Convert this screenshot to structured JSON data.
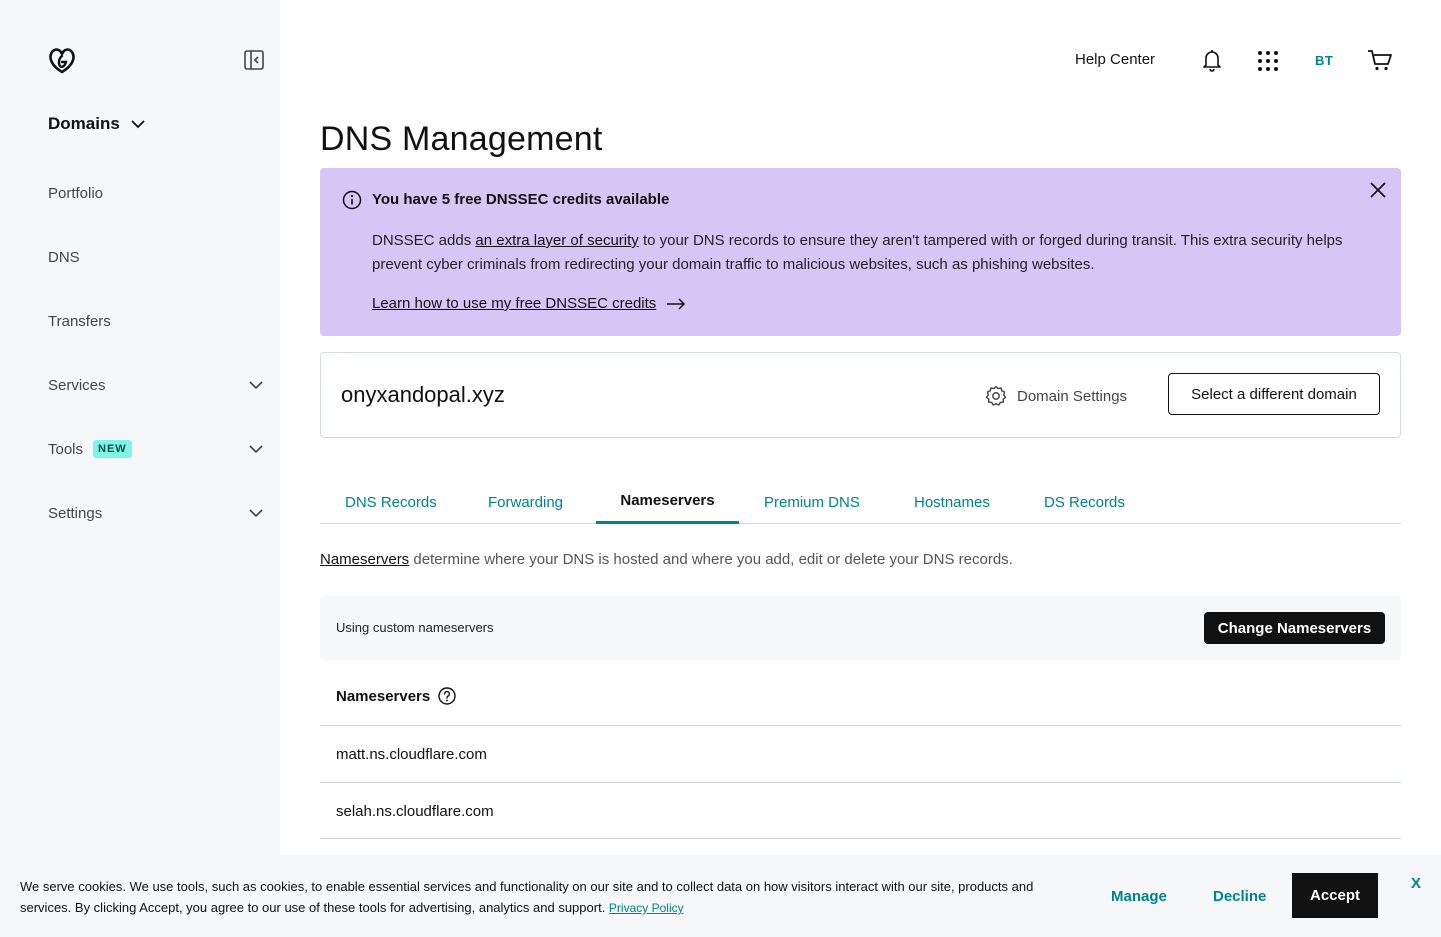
{
  "sidebar": {
    "logo_icon": "godaddy-logo-icon",
    "collapse_icon": "sidebar-collapse-icon",
    "section_title": "Domains",
    "items": [
      {
        "label": "Portfolio"
      },
      {
        "label": "DNS"
      },
      {
        "label": "Transfers"
      },
      {
        "label": "Services",
        "expandable": true
      },
      {
        "label": "Tools",
        "badge": "NEW",
        "expandable": true
      },
      {
        "label": "Settings",
        "expandable": true
      }
    ]
  },
  "topbar": {
    "help_label": "Help Center",
    "avatar_initials": "BT"
  },
  "page": {
    "title": "DNS Management"
  },
  "alert": {
    "title": "You have 5 free DNSSEC credits available",
    "body_prefix": "DNSSEC adds ",
    "body_link": "an extra layer of security",
    "body_suffix": " to your DNS records to ensure they aren't tampered with or forged during transit. This extra security helps prevent cyber criminals from redirecting your domain traffic to malicious websites, such as phishing websites.",
    "learn_link": "Learn how to use my free DNSSEC credits",
    "background_color": "#d6c6f5"
  },
  "domain": {
    "name": "onyxandopal.xyz",
    "settings_label": "Domain Settings",
    "select_label": "Select a different domain"
  },
  "tabs": [
    {
      "label": "DNS Records",
      "active": false
    },
    {
      "label": "Forwarding",
      "active": false
    },
    {
      "label": "Nameservers",
      "active": true
    },
    {
      "label": "Premium DNS",
      "active": false
    },
    {
      "label": "Hostnames",
      "active": false
    },
    {
      "label": "DS Records",
      "active": false
    }
  ],
  "nameservers": {
    "desc_link": "Nameservers",
    "desc_text": " determine where your DNS is hosted and where you add, edit or delete your DNS records.",
    "status_text": "Using custom nameservers",
    "change_label": "Change Nameservers",
    "header": "Nameservers",
    "list": [
      "matt.ns.cloudflare.com",
      "selah.ns.cloudflare.com"
    ]
  },
  "cookie": {
    "text": "We serve cookies. We use tools, such as cookies, to enable essential services and functionality on our site and to collect data on how visitors interact with our site, products and services. By clicking Accept, you agree to our use of these tools for advertising, analytics and support. ",
    "privacy_link": "Privacy Policy",
    "manage_label": "Manage",
    "decline_label": "Decline",
    "accept_label": "Accept",
    "close_label": "X"
  },
  "colors": {
    "accent": "#00838c",
    "sidebar_bg": "#f5f7f8",
    "primary_button": "#111111"
  }
}
